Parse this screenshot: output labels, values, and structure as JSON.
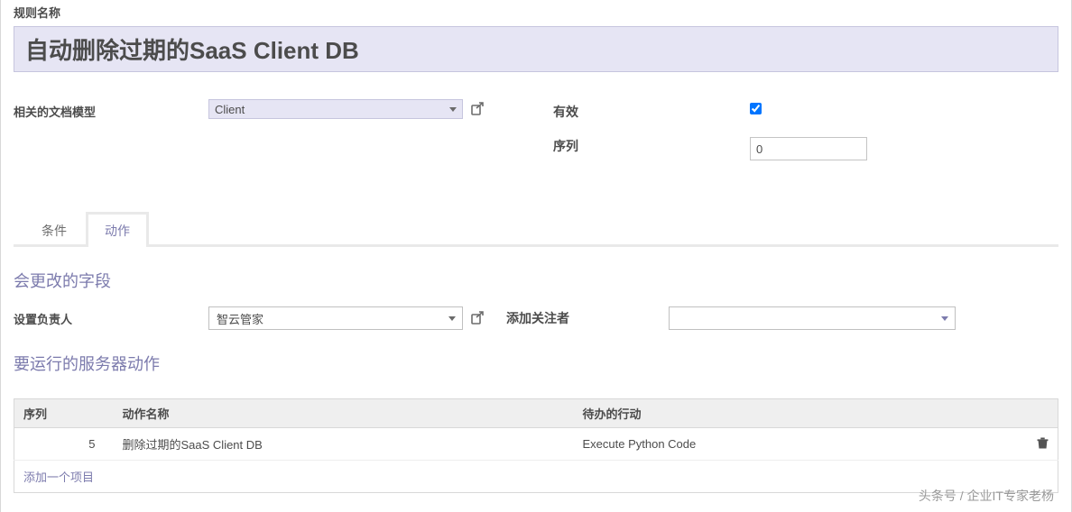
{
  "header": {
    "rule_name_label": "规则名称",
    "rule_name_value": "自动删除过期的SaaS Client DB"
  },
  "fields": {
    "related_model_label": "相关的文档模型",
    "related_model_value": "Client",
    "active_label": "有效",
    "active_checked": true,
    "sequence_label": "序列",
    "sequence_value": "0"
  },
  "tabs": {
    "conditions": "条件",
    "actions": "动作"
  },
  "section": {
    "fields_to_change": "会更改的字段",
    "set_responsible_label": "设置负责人",
    "set_responsible_value": "智云管家",
    "add_followers_label": "添加关注者",
    "server_actions_title": "要运行的服务器动作"
  },
  "table": {
    "col_sequence": "序列",
    "col_action_name": "动作名称",
    "col_todo_action": "待办的行动",
    "rows": [
      {
        "seq": "5",
        "name": "删除过期的SaaS Client DB",
        "todo": "Execute Python Code"
      }
    ],
    "add_item": "添加一个项目"
  },
  "watermark": "头条号 / 企业IT专家老杨"
}
